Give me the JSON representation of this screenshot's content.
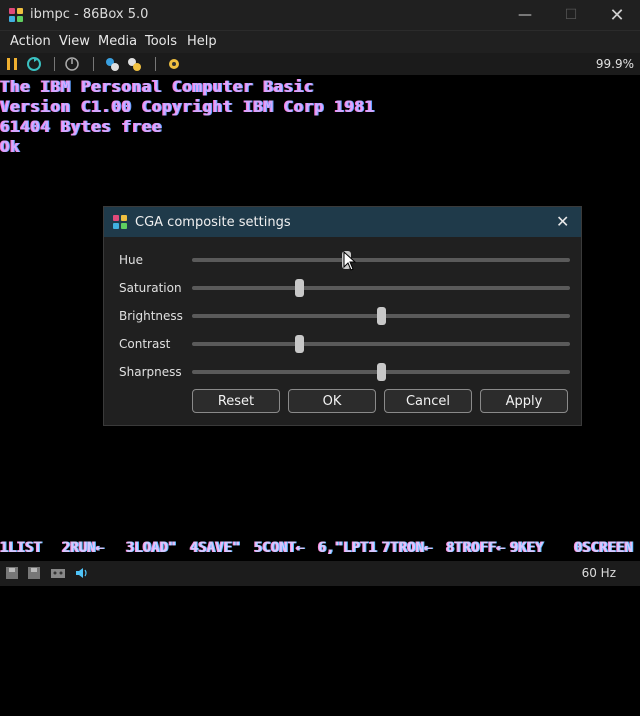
{
  "window": {
    "title": "ibmpc - 86Box 5.0",
    "minimize": "—",
    "maximize": "☐",
    "close": "✕"
  },
  "menu": {
    "items": [
      "Action",
      "View",
      "Media",
      "Tools",
      "Help"
    ]
  },
  "toolbar": {
    "speed": "99.9%",
    "icons": [
      "pause-icon",
      "reset-icon",
      "ctrl-alt-del-icon",
      "settings-icon",
      "hard-reset-icon",
      "global-settings-icon"
    ]
  },
  "screen": {
    "lines": [
      "The IBM Personal Computer Basic",
      "Version C1.00 Copyright IBM Corp 1981",
      "61404 Bytes free",
      "Ok"
    ],
    "fkeys": [
      "1LIST",
      "2RUN←",
      "3LOAD\"",
      "4SAVE\"",
      "5CONT←",
      "6,\"LPT1",
      "7TRON←",
      "8TROFF←",
      "9KEY",
      "0SCREEN"
    ]
  },
  "dialog": {
    "title": "CGA composite settings",
    "close": "✕",
    "sliders": [
      {
        "label": "Hue",
        "value": 0.41
      },
      {
        "label": "Saturation",
        "value": 0.285
      },
      {
        "label": "Brightness",
        "value": 0.5
      },
      {
        "label": "Contrast",
        "value": 0.285
      },
      {
        "label": "Sharpness",
        "value": 0.5
      }
    ],
    "buttons": {
      "reset": "Reset",
      "ok": "OK",
      "cancel": "Cancel",
      "apply": "Apply"
    }
  },
  "status": {
    "refresh": "60 Hz"
  },
  "colors": {
    "dialog_title_bg": "#1f3a4a",
    "accent": "#4fc3f7"
  }
}
